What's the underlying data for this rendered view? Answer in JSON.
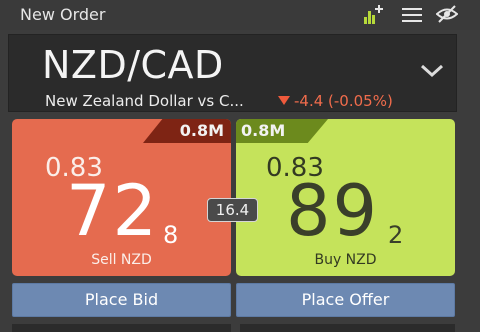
{
  "header": {
    "title": "New Order",
    "icons": [
      "add-chart-icon",
      "menu-icon",
      "hide-icon"
    ],
    "accent_color": "#b6d93a"
  },
  "instrument": {
    "symbol": "NZD/CAD",
    "description": "New Zealand Dollar vs C...",
    "change": "-4.4 (-0.05%)",
    "change_direction": "down",
    "change_color": "#f06c4c"
  },
  "sell": {
    "size": "0.8M",
    "big_figure": "0.83",
    "pips": "72",
    "tenth": "8",
    "label": "Sell NZD",
    "color": "#e56b4f"
  },
  "buy": {
    "size": "0.8M",
    "big_figure": "0.83",
    "pips": "89",
    "tenth": "2",
    "label": "Buy NZD",
    "color": "#c5e35b"
  },
  "spread": "16.4",
  "actions": {
    "bid_label": "Place Bid",
    "offer_label": "Place Offer",
    "button_color": "#6d89b2"
  }
}
